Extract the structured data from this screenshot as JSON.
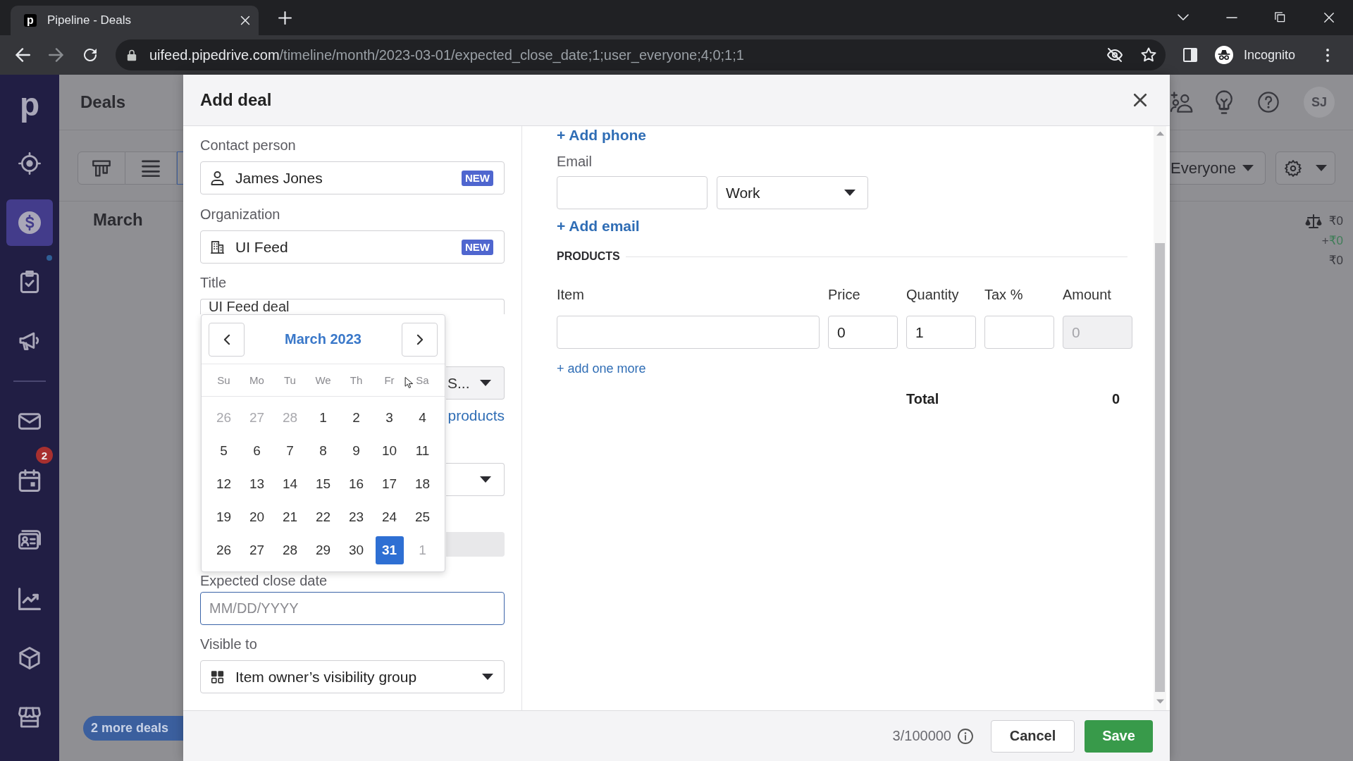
{
  "browser": {
    "tab_favicon": "p",
    "tab_title": "Pipeline - Deals",
    "url_host": "uifeed.pipedrive.com",
    "url_path": "/timeline/month/2023-03-01/expected_close_date;1;user_everyone;4;0;1;1",
    "profile": "Incognito"
  },
  "sidebar": {
    "logo": "p",
    "groups": [
      [
        {
          "selected": false,
          "dot": false
        },
        {
          "selected": true,
          "dot": false
        },
        {
          "selected": false,
          "dot": true
        },
        {
          "selected": false,
          "dot": false
        }
      ],
      [
        {
          "selected": false,
          "dot": false
        },
        {
          "selected": false,
          "dot": false,
          "badge": "2"
        },
        {
          "selected": false,
          "dot": false
        },
        {
          "selected": false,
          "dot": false
        },
        {
          "selected": false,
          "dot": false
        },
        {
          "selected": false,
          "dot": false
        }
      ]
    ]
  },
  "header": {
    "title": "Deals",
    "avatar": "SJ"
  },
  "toolbar": {
    "views": [
      {
        "selected": false
      },
      {
        "selected": false
      },
      {
        "selected": true
      }
    ],
    "owner_filter": "Everyone"
  },
  "timeline": {
    "month": "March",
    "totals": [
      {
        "kind": "balance",
        "amount": "₹0"
      },
      {
        "kind": "won",
        "sign": "+",
        "amount": "₹0"
      },
      {
        "kind": "plain",
        "amount": "₹0"
      }
    ],
    "more_deals": "2 more deals"
  },
  "dialog": {
    "title": "Add deal",
    "contact_person": {
      "label": "Contact person",
      "value": "James Jones",
      "badge": "NEW"
    },
    "organization": {
      "label": "Organization",
      "value": "UI Feed",
      "badge": "NEW"
    },
    "title_field": {
      "label": "Title",
      "value": "UI Feed deal"
    },
    "currency": {
      "value": "S..."
    },
    "products_link": "products",
    "expected_close_date": {
      "label": "Expected close date",
      "placeholder": "MM/DD/YYYY",
      "focused": true
    },
    "visible_to": {
      "label": "Visible to",
      "value": "Item owner’s visibility group"
    },
    "date_picker": {
      "month_title": "March 2023",
      "weekdays": [
        "Su",
        "Mo",
        "Tu",
        "We",
        "Th",
        "Fr",
        "Sa"
      ],
      "weeks": [
        [
          {
            "day": "26",
            "muted": true,
            "selected": false
          },
          {
            "day": "27",
            "muted": true,
            "selected": false
          },
          {
            "day": "28",
            "muted": true,
            "selected": false
          },
          {
            "day": "1",
            "muted": false,
            "selected": false
          },
          {
            "day": "2",
            "muted": false,
            "selected": false
          },
          {
            "day": "3",
            "muted": false,
            "selected": false
          },
          {
            "day": "4",
            "muted": false,
            "selected": false
          }
        ],
        [
          {
            "day": "5",
            "muted": false,
            "selected": false
          },
          {
            "day": "6",
            "muted": false,
            "selected": false
          },
          {
            "day": "7",
            "muted": false,
            "selected": false
          },
          {
            "day": "8",
            "muted": false,
            "selected": false
          },
          {
            "day": "9",
            "muted": false,
            "selected": false
          },
          {
            "day": "10",
            "muted": false,
            "selected": false
          },
          {
            "day": "11",
            "muted": false,
            "selected": false
          }
        ],
        [
          {
            "day": "12",
            "muted": false,
            "selected": false
          },
          {
            "day": "13",
            "muted": false,
            "selected": false
          },
          {
            "day": "14",
            "muted": false,
            "selected": false
          },
          {
            "day": "15",
            "muted": false,
            "selected": false
          },
          {
            "day": "16",
            "muted": false,
            "selected": false
          },
          {
            "day": "17",
            "muted": false,
            "selected": false
          },
          {
            "day": "18",
            "muted": false,
            "selected": false
          }
        ],
        [
          {
            "day": "19",
            "muted": false,
            "selected": false
          },
          {
            "day": "20",
            "muted": false,
            "selected": false
          },
          {
            "day": "21",
            "muted": false,
            "selected": false
          },
          {
            "day": "22",
            "muted": false,
            "selected": false
          },
          {
            "day": "23",
            "muted": false,
            "selected": false
          },
          {
            "day": "24",
            "muted": false,
            "selected": false
          },
          {
            "day": "25",
            "muted": false,
            "selected": false
          }
        ],
        [
          {
            "day": "26",
            "muted": false,
            "selected": false
          },
          {
            "day": "27",
            "muted": false,
            "selected": false
          },
          {
            "day": "28",
            "muted": false,
            "selected": false
          },
          {
            "day": "29",
            "muted": false,
            "selected": false
          },
          {
            "day": "30",
            "muted": false,
            "selected": false
          },
          {
            "day": "31",
            "muted": false,
            "selected": true
          },
          {
            "day": "1",
            "muted": true,
            "selected": false
          }
        ]
      ]
    },
    "add_phone": "+ Add phone",
    "email": {
      "label": "Email",
      "type": "Work"
    },
    "add_email": "+ Add email",
    "products": {
      "heading": "PRODUCTS",
      "columns": [
        "Item",
        "Price",
        "Quantity",
        "Tax %",
        "Amount"
      ],
      "row": [
        {
          "disabled": false
        },
        {
          "value": "0",
          "disabled": false
        },
        {
          "value": "1",
          "disabled": false
        },
        {
          "disabled": false
        },
        {
          "value": "0",
          "disabled": true
        }
      ],
      "add_more": "+ add one more",
      "total_label": "Total",
      "total_value": "0"
    },
    "footer": {
      "counter": "3/100000",
      "buttons": [
        {
          "kind": "secondary",
          "label": "Cancel"
        },
        {
          "kind": "primary",
          "label": "Save"
        }
      ]
    }
  }
}
